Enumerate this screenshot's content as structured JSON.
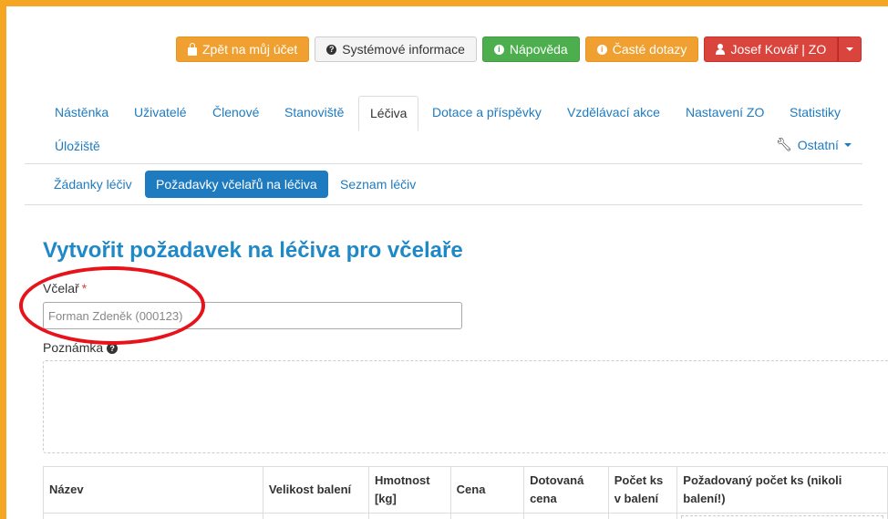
{
  "top_buttons": {
    "back_label": "Zpět na můj účet",
    "sysinfo_label": "Systémové informace",
    "help_label": "Nápověda",
    "faq_label": "Časté dotazy",
    "user_label": "Josef Kovář | ZO"
  },
  "main_nav": [
    "Nástěnka",
    "Uživatelé",
    "Členové",
    "Stanoviště",
    "Léčiva",
    "Dotace a příspěvky",
    "Vzdělávací akce",
    "Nastavení ZO",
    "Statistiky"
  ],
  "main_nav_row2": [
    "Úložiště"
  ],
  "other_menu_label": "Ostatní",
  "sub_nav": [
    "Žádanky léčiv",
    "Požadavky včelařů na léčiva",
    "Seznam léčiv"
  ],
  "page_title": "Vytvořit požadavek na léčiva pro včelaře",
  "form": {
    "beekeeper_label": "Včelař",
    "required_mark": "*",
    "beekeeper_value": "Forman Zdeněk (000123)",
    "note_label": "Poznámka"
  },
  "table": {
    "headers": [
      "Název",
      "Velikost balení",
      "Hmotnost [kg]",
      "Cena",
      "Dotovaná cena",
      "Počet ks v balení",
      "Požadovaný počet ks (nikoli balení!)"
    ]
  },
  "colors": {
    "accent": "#1f7bbf",
    "border": "#f5a623",
    "highlight": "#e8121a"
  }
}
